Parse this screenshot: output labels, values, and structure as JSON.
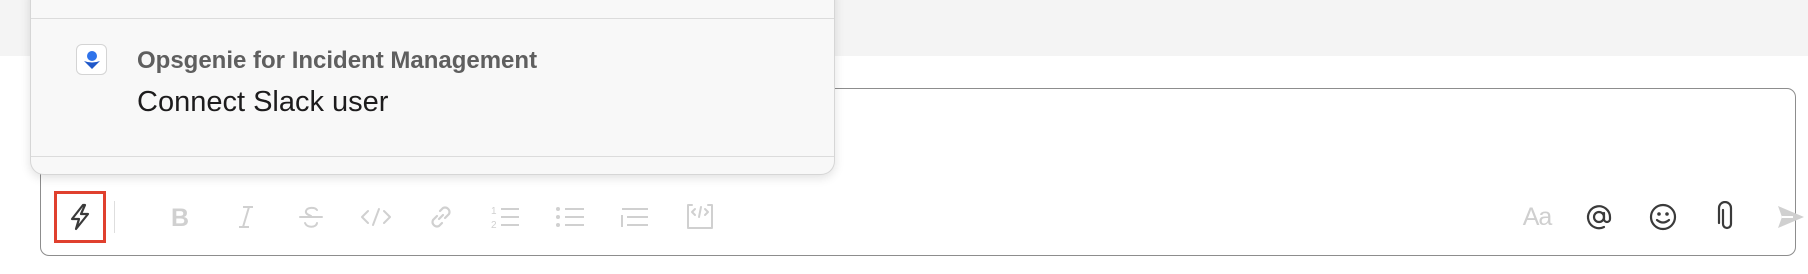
{
  "popup": {
    "app_name": "Opsgenie for Incident Management",
    "item_label": "Connect Slack user",
    "app_icon": "opsgenie-icon"
  },
  "composer": {
    "toolbar": {
      "shortcut_icon": "lightning-bolt-icon",
      "format_icons": [
        "bold-icon",
        "italic-icon",
        "strikethrough-icon",
        "code-icon",
        "link-icon",
        "ordered-list-icon",
        "bulleted-list-icon",
        "blockquote-icon",
        "code-block-icon"
      ],
      "formatting_label": "Aa",
      "right_icons": [
        "mention-icon",
        "emoji-icon",
        "attachment-icon",
        "send-icon"
      ]
    }
  },
  "colors": {
    "highlight": "#e0402e",
    "disabled_icon": "#d0d0d0",
    "active_icon": "#3a3a3a",
    "opsgenie_blue": "#2f73ea"
  }
}
